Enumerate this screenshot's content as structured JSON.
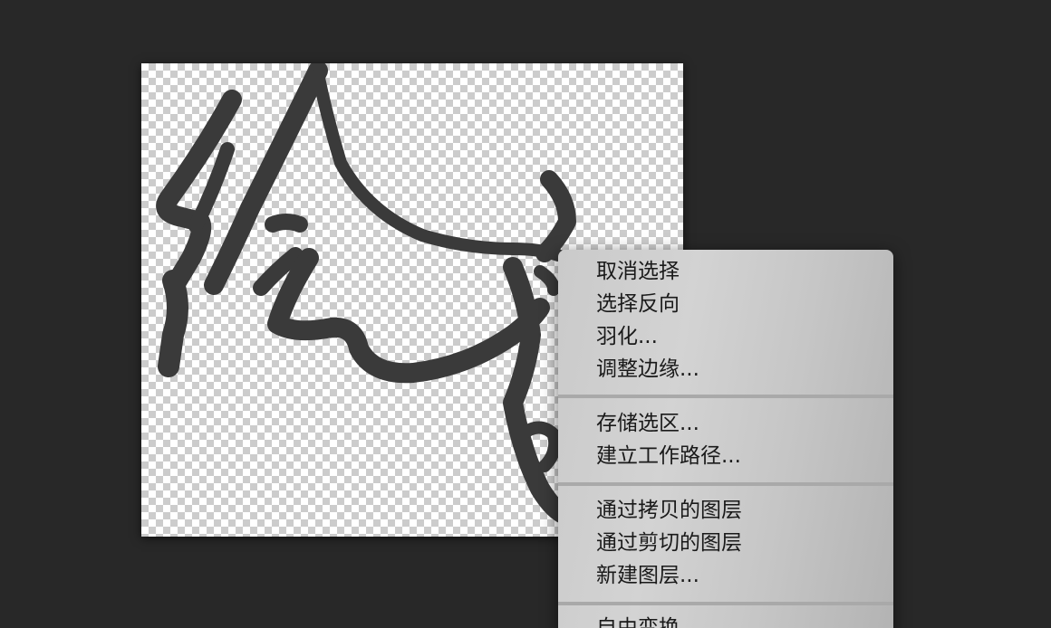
{
  "workspace": {
    "background_color": "#282828"
  },
  "canvas": {
    "background": "transparency-checkerboard",
    "artwork": "calligraphy-strokes",
    "ink_color": "#3a3a3a"
  },
  "context_menu": {
    "groups": [
      {
        "items": [
          {
            "label": "取消选择"
          },
          {
            "label": "选择反向"
          },
          {
            "label": "羽化..."
          },
          {
            "label": "调整边缘..."
          }
        ]
      },
      {
        "items": [
          {
            "label": "存储选区..."
          },
          {
            "label": "建立工作路径..."
          }
        ]
      },
      {
        "items": [
          {
            "label": "通过拷贝的图层"
          },
          {
            "label": "通过剪切的图层"
          },
          {
            "label": "新建图层..."
          }
        ]
      },
      {
        "items": [
          {
            "label": "自由变换"
          }
        ]
      }
    ]
  }
}
